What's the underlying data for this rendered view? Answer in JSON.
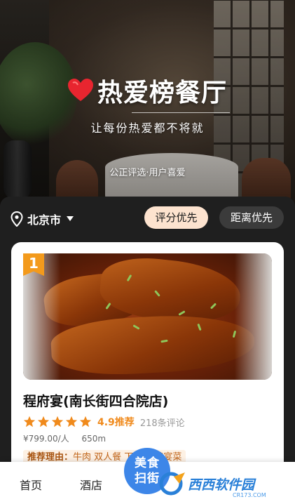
{
  "hero": {
    "title": "热爱榜餐厅",
    "subtitle": "让每份热爱都不将就",
    "tagline": "公正评选·用户喜爱"
  },
  "filter": {
    "city": "北京市",
    "sort_rating": "评分优先",
    "sort_distance": "距离优先"
  },
  "restaurant": {
    "rank": "1",
    "name": "程府宴(南长街四合院店)",
    "stars": 5,
    "score_text": "4.9推荐",
    "review_count": "218条评论",
    "price": "¥799.00/人",
    "distance": "650m",
    "reason_label": "推荐理由：",
    "reason_text": "牛肉 双人餐 下 宫廷鸭宴菜"
  },
  "nav": {
    "home": "首页",
    "hotel": "酒店",
    "scan_line1": "美食",
    "scan_line2": "扫街"
  },
  "watermark": {
    "text": "西西软件园",
    "url": "CR173.COM"
  },
  "colors": {
    "accent_orange": "#f08a1c",
    "sort_active_bg": "#fde3cf",
    "scan_blue": "#3d86e8",
    "heart_red": "#e8252f"
  }
}
